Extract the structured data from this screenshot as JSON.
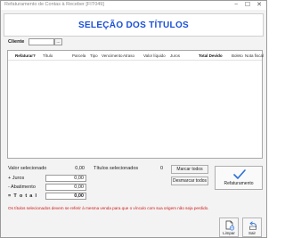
{
  "window": {
    "title": "Refaturamento de Contas à Receber [FIT049]",
    "minimize": "−",
    "maximize": "☐",
    "close": "✕"
  },
  "header": {
    "title": "SELEÇÃO DOS TÍTULOS"
  },
  "client": {
    "label": "Cliente",
    "value": "",
    "lookup_label": "..."
  },
  "grid": {
    "columns": [
      "Refaturar?",
      "Título",
      "Parcela",
      "Tipo",
      "Vencimento",
      "Atraso",
      "Valor líquido",
      "Juros",
      "Total Devido",
      "Boleto",
      "Nota fiscal"
    ],
    "rows": []
  },
  "summary": {
    "valor_selecionado_label": "Valor selecionado",
    "valor_selecionado_value": "0,00",
    "titulos_selecionados_label": "Títulos selecionados",
    "titulos_selecionados_value": "0",
    "juros_label": "+ Juros",
    "juros_value": "0,00",
    "abatimento_label": "- Abatimento",
    "abatimento_value": "0,00",
    "total_label": "= T o t a l",
    "total_value": "0,00"
  },
  "buttons": {
    "marcar_todos": "Marcar todos",
    "desmarcar_todos": "Desmarcar todos",
    "refaturamento": "Refaturamento",
    "limpar": "Limpar",
    "sair": "Sair"
  },
  "warning": "Os títulos selecionados devem se referir à mesma venda para que o vínculo com sua origem não seja perdido.",
  "icons": {
    "checkmark": "checkmark-icon",
    "clear": "clear-document-icon",
    "exit": "exit-arrow-icon"
  },
  "colors": {
    "title_blue": "#1a4fd6",
    "warning_red": "#d01717",
    "check_blue": "#2b6fd6"
  }
}
